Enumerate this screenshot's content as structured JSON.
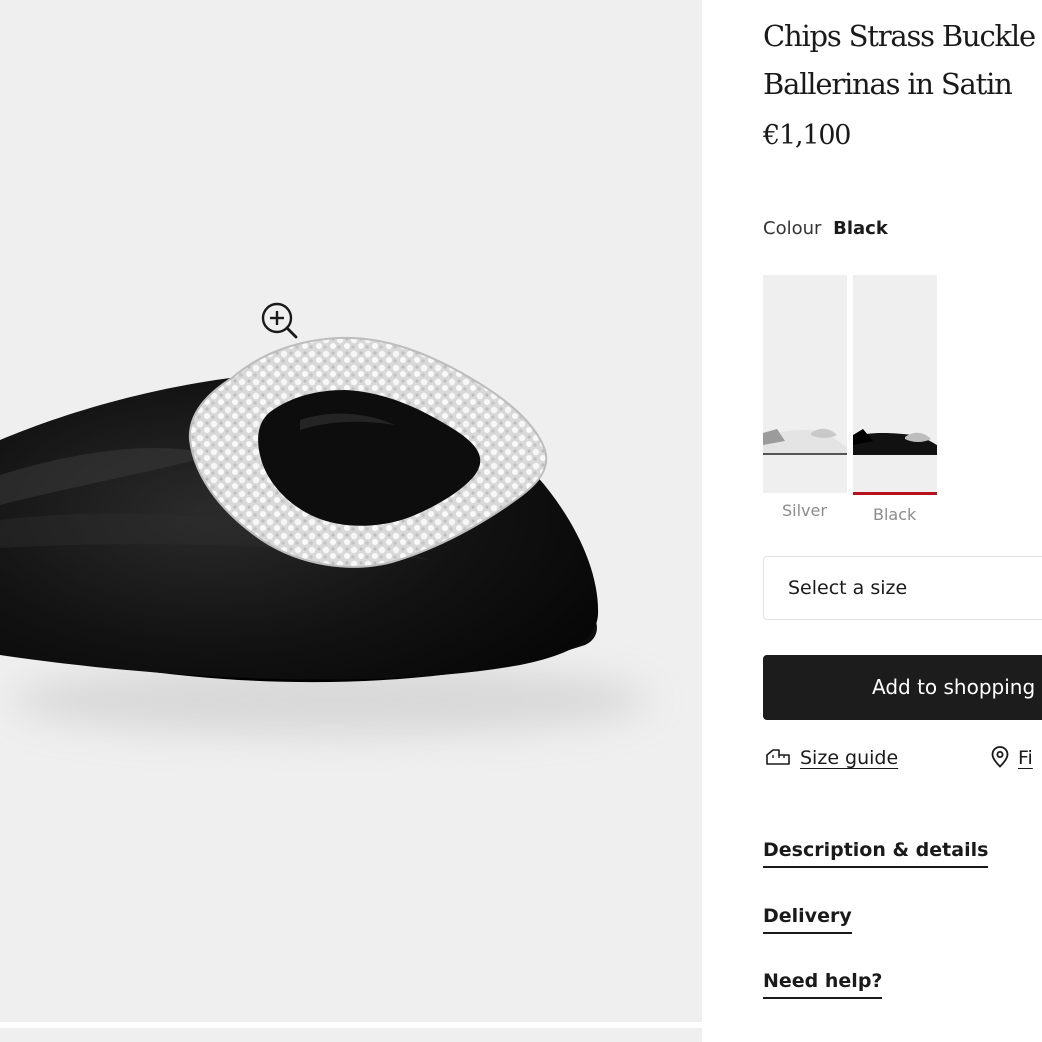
{
  "product": {
    "title_line1": "Chips Strass Buckle",
    "title_line2": "Ballerinas in Satin",
    "price": "€1,100"
  },
  "colour": {
    "label": "Colour",
    "selected": "Black",
    "options": [
      {
        "name": "Silver",
        "selected": false
      },
      {
        "name": "Black",
        "selected": true
      }
    ],
    "selected_indicator_color": "#b5121b"
  },
  "size_select": {
    "placeholder": "Select a size"
  },
  "cart": {
    "button_label": "Add to shopping"
  },
  "links": {
    "size_guide": "Size guide",
    "find_store": "Fi"
  },
  "accordion": {
    "description": "Description & details",
    "delivery": "Delivery",
    "help": "Need help?"
  },
  "icons": {
    "zoom": "zoom-in-icon",
    "size_guide": "ruler-icon",
    "find_store": "location-pin-icon"
  },
  "colors": {
    "button_background": "#1c1c1c",
    "gallery_background": "#efefef"
  }
}
